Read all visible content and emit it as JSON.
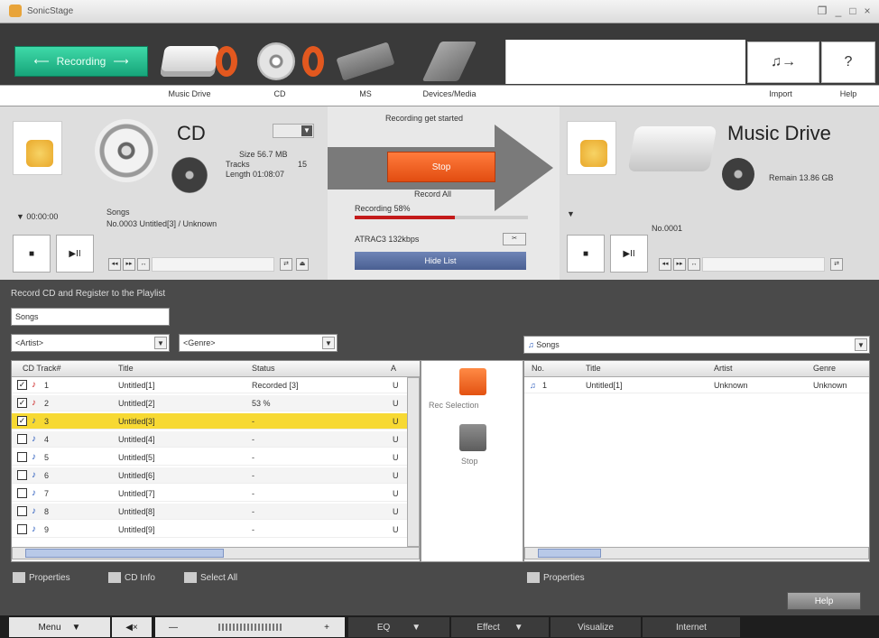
{
  "window": {
    "title": "SonicStage",
    "controls": [
      "❐",
      "_",
      "□",
      "×"
    ]
  },
  "top": {
    "recording_tab": "Recording",
    "devices": [
      {
        "label": "Music Drive",
        "icon": "hdd-device-icon"
      },
      {
        "label": "CD",
        "icon": "cd-icon"
      },
      {
        "label": "MS",
        "icon": "memory-stick-icon"
      },
      {
        "label": "Devices/Media",
        "icon": "media-device-icon"
      }
    ],
    "import_label": "Import",
    "help_label": "Help",
    "import_glyph": "♫→",
    "help_glyph": "?"
  },
  "cd_pane": {
    "title": "CD",
    "size": "Size 56.7 MB",
    "tracks_label": "Tracks",
    "tracks_value": "15",
    "length": "Length 01:08:07",
    "time": "▼ 00:00:00",
    "songs_label": "Songs",
    "now_playing": "No.0003 Untitled[3] / Unknown"
  },
  "center_pane": {
    "status": "Recording get started",
    "stop_label": "Stop",
    "record_all": "Record All",
    "recording_pct_text": "Recording 58%",
    "recording_progress": 0.58,
    "format": "ATRAC3 132kbps",
    "hide_list": "Hide List"
  },
  "md_pane": {
    "title": "Music Drive",
    "remain": "Remain 13.86 GB",
    "track_no": "No.0001"
  },
  "section": {
    "title": "Record CD and Register to the Playlist",
    "playlist_name": "Songs",
    "artist_filter": "<Artist>",
    "genre_filter": "<Genre>"
  },
  "cd_table": {
    "columns": [
      "CD Track#",
      "Title",
      "Status",
      "A"
    ],
    "rows": [
      {
        "checked": true,
        "num": "1",
        "title": "Untitled[1]",
        "status": "Recorded [3]",
        "a": "U",
        "icon": "♪"
      },
      {
        "checked": true,
        "num": "2",
        "title": "Untitled[2]",
        "status": "53 %",
        "a": "U",
        "icon": "♪"
      },
      {
        "checked": true,
        "num": "3",
        "title": "Untitled[3]",
        "status": "-",
        "a": "U",
        "icon": "♪"
      },
      {
        "checked": false,
        "num": "4",
        "title": "Untitled[4]",
        "status": "-",
        "a": "U",
        "icon": "♪"
      },
      {
        "checked": false,
        "num": "5",
        "title": "Untitled[5]",
        "status": "-",
        "a": "U",
        "icon": "♪"
      },
      {
        "checked": false,
        "num": "6",
        "title": "Untitled[6]",
        "status": "-",
        "a": "U",
        "icon": "♪"
      },
      {
        "checked": false,
        "num": "7",
        "title": "Untitled[7]",
        "status": "-",
        "a": "U",
        "icon": "♪"
      },
      {
        "checked": false,
        "num": "8",
        "title": "Untitled[8]",
        "status": "-",
        "a": "U",
        "icon": "♪"
      },
      {
        "checked": false,
        "num": "9",
        "title": "Untitled[9]",
        "status": "-",
        "a": "U",
        "icon": "♪"
      }
    ]
  },
  "middle": {
    "rec_selection": "Rec Selection",
    "stop": "Stop"
  },
  "playlist_table": {
    "selector": "Songs",
    "columns": [
      "No.",
      "Title",
      "Artist",
      "Genre"
    ],
    "rows": [
      {
        "no": "1",
        "title": "Untitled[1]",
        "artist": "Unknown",
        "genre": "Unknown"
      }
    ]
  },
  "footer": {
    "properties_left": "Properties",
    "cd_info": "CD Info",
    "select_all": "Select All",
    "properties_right": "Properties",
    "help": "Help"
  },
  "bottombar": {
    "menu": "Menu",
    "minus": "—",
    "plus": "+",
    "eq": "EQ",
    "effect": "Effect",
    "visualize": "Visualize",
    "internet": "Internet"
  },
  "colors": {
    "accent_green": "#20b887",
    "orange": "#e85a1c",
    "selected_row": "#f7d933"
  }
}
